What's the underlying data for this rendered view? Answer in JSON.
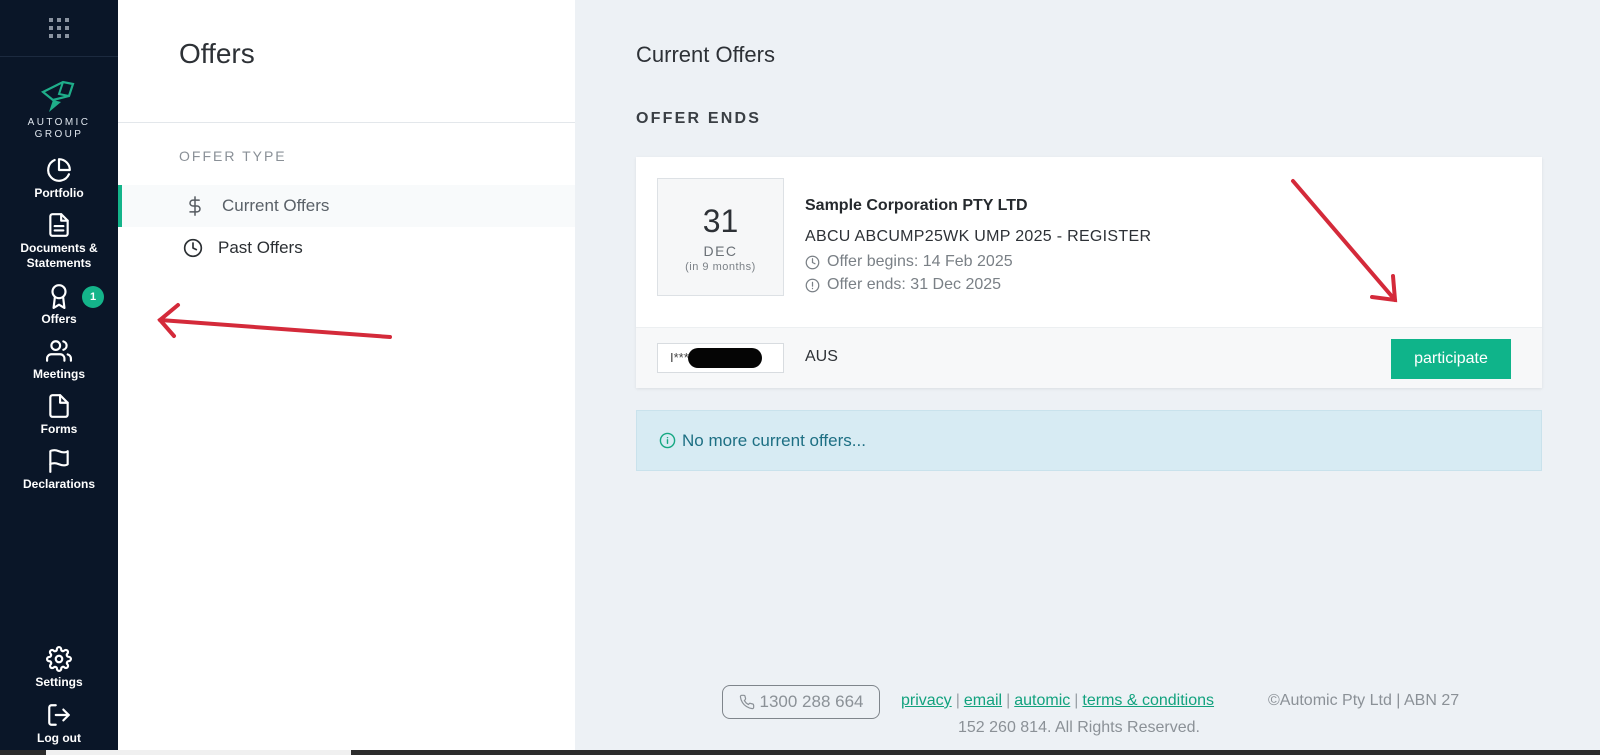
{
  "sidebar": {
    "logo_text_line1": "AUTOMIC",
    "logo_text_line2": "GROUP",
    "items": [
      {
        "label": "Portfolio",
        "icon": "pie-chart-icon"
      },
      {
        "label": "Documents &",
        "label2": "Statements",
        "icon": "document-icon"
      },
      {
        "label": "Offers",
        "icon": "award-icon",
        "badge": "1"
      },
      {
        "label": "Meetings",
        "icon": "users-icon"
      },
      {
        "label": "Forms",
        "icon": "file-icon"
      },
      {
        "label": "Declarations",
        "icon": "flag-icon"
      }
    ],
    "bottom_items": [
      {
        "label": "Settings",
        "icon": "gear-icon"
      },
      {
        "label": "Log out",
        "icon": "logout-icon"
      }
    ]
  },
  "panel": {
    "title": "Offers",
    "offer_type_label": "OFFER TYPE",
    "types": [
      {
        "label": "Current Offers",
        "icon": "dollar-icon",
        "active": true
      },
      {
        "label": "Past Offers",
        "icon": "clock-icon",
        "active": false
      }
    ]
  },
  "main": {
    "title": "Current Offers",
    "section_label": "OFFER ENDS",
    "offer": {
      "day": "31",
      "month": "DEC",
      "relative": "(in 9 months)",
      "company": "Sample Corporation PTY LTD",
      "name": "ABCU ABCUMP25WK UMP 2025 - REGISTER",
      "begins": "Offer begins: 14 Feb 2025",
      "ends": "Offer ends: 31 Dec 2025",
      "holder_prefix": "I***",
      "country": "AUS",
      "participate_label": "participate"
    },
    "info_message": "No more current offers..."
  },
  "footer": {
    "phone": "1300 288 664",
    "links": [
      "privacy",
      "email",
      "automic",
      "terms & conditions"
    ],
    "copyright_line1": "©Automic Pty Ltd | ABN 27",
    "copyright_line2": "152 260 814. All Rights Reserved."
  },
  "colors": {
    "sidebar_bg": "#0a1628",
    "accent": "#14b48a",
    "info_bg": "#d7ebf3",
    "annotation_arrow": "#d42a3a"
  }
}
